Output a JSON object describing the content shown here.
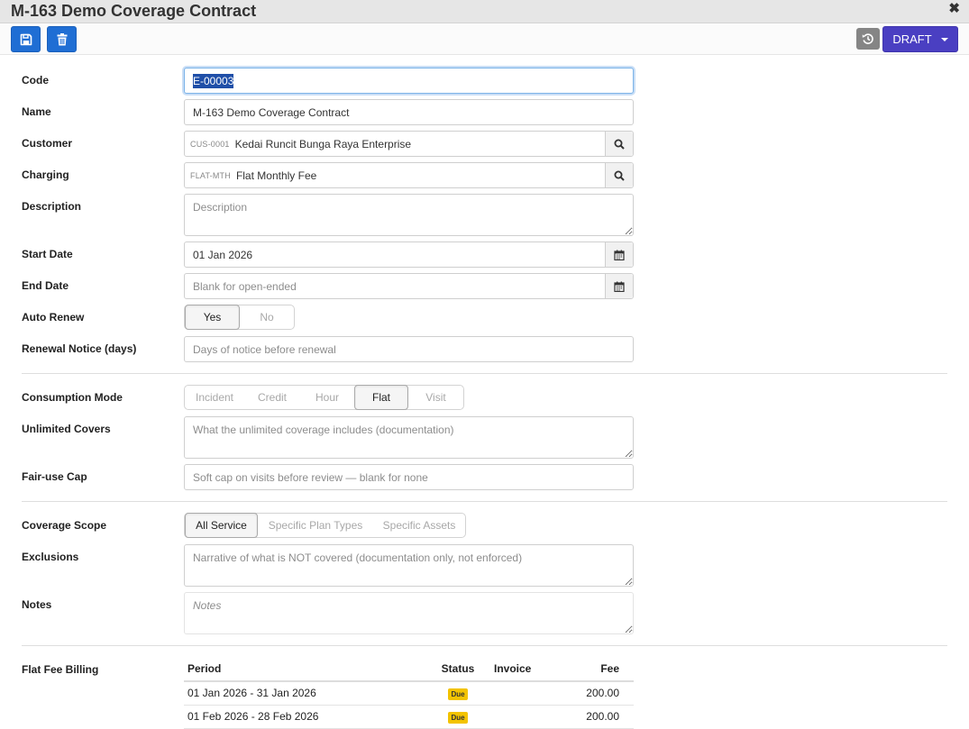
{
  "window": {
    "title": "M-163 Demo Coverage Contract",
    "close_glyph": "✖"
  },
  "toolbar": {
    "save_icon": "save-icon",
    "delete_icon": "trash-icon",
    "restore_icon": "history-icon",
    "status_label": "DRAFT"
  },
  "form": {
    "code": {
      "label": "Code",
      "value": "E-00003"
    },
    "name": {
      "label": "Name",
      "value": "M-163 Demo Coverage Contract"
    },
    "customer": {
      "label": "Customer",
      "code": "CUS-0001",
      "value": "Kedai Runcit Bunga Raya Enterprise"
    },
    "charging": {
      "label": "Charging",
      "code": "FLAT-MTH",
      "value": "Flat Monthly Fee"
    },
    "description": {
      "label": "Description",
      "placeholder": "Description"
    },
    "start_date": {
      "label": "Start Date",
      "value": "01 Jan 2026"
    },
    "end_date": {
      "label": "End Date",
      "placeholder": "Blank for open-ended"
    },
    "auto_renew": {
      "label": "Auto Renew",
      "options": [
        "Yes",
        "No"
      ],
      "selected": "Yes"
    },
    "renewal_notice": {
      "label": "Renewal Notice (days)",
      "placeholder": "Days of notice before renewal"
    },
    "consumption_mode": {
      "label": "Consumption Mode",
      "options": [
        "Incident",
        "Credit",
        "Hour",
        "Flat",
        "Visit"
      ],
      "selected": "Flat"
    },
    "unlimited_covers": {
      "label": "Unlimited Covers",
      "placeholder": "What the unlimited coverage includes (documentation)"
    },
    "fair_use_cap": {
      "label": "Fair-use Cap",
      "placeholder": "Soft cap on visits before review — blank for none"
    },
    "coverage_scope": {
      "label": "Coverage Scope",
      "options": [
        "All Service",
        "Specific Plan Types",
        "Specific Assets"
      ],
      "selected": "All Service"
    },
    "exclusions": {
      "label": "Exclusions",
      "placeholder": "Narrative of what is NOT covered (documentation only, not enforced)"
    },
    "notes": {
      "label": "Notes",
      "placeholder": "Notes"
    }
  },
  "billing": {
    "label": "Flat Fee Billing",
    "columns": [
      "Period",
      "Status",
      "Invoice",
      "Fee"
    ],
    "rows": [
      {
        "period": "01 Jan 2026 - 31 Jan 2026",
        "status": "Due",
        "invoice": "",
        "fee": "200.00"
      },
      {
        "period": "01 Feb 2026 - 28 Feb 2026",
        "status": "Due",
        "invoice": "",
        "fee": "200.00"
      }
    ]
  },
  "colors": {
    "primary_button": "#1f6ed4",
    "draft_button": "#4a3fc2",
    "restore_button": "#858585",
    "due_badge": "#f3c300"
  }
}
